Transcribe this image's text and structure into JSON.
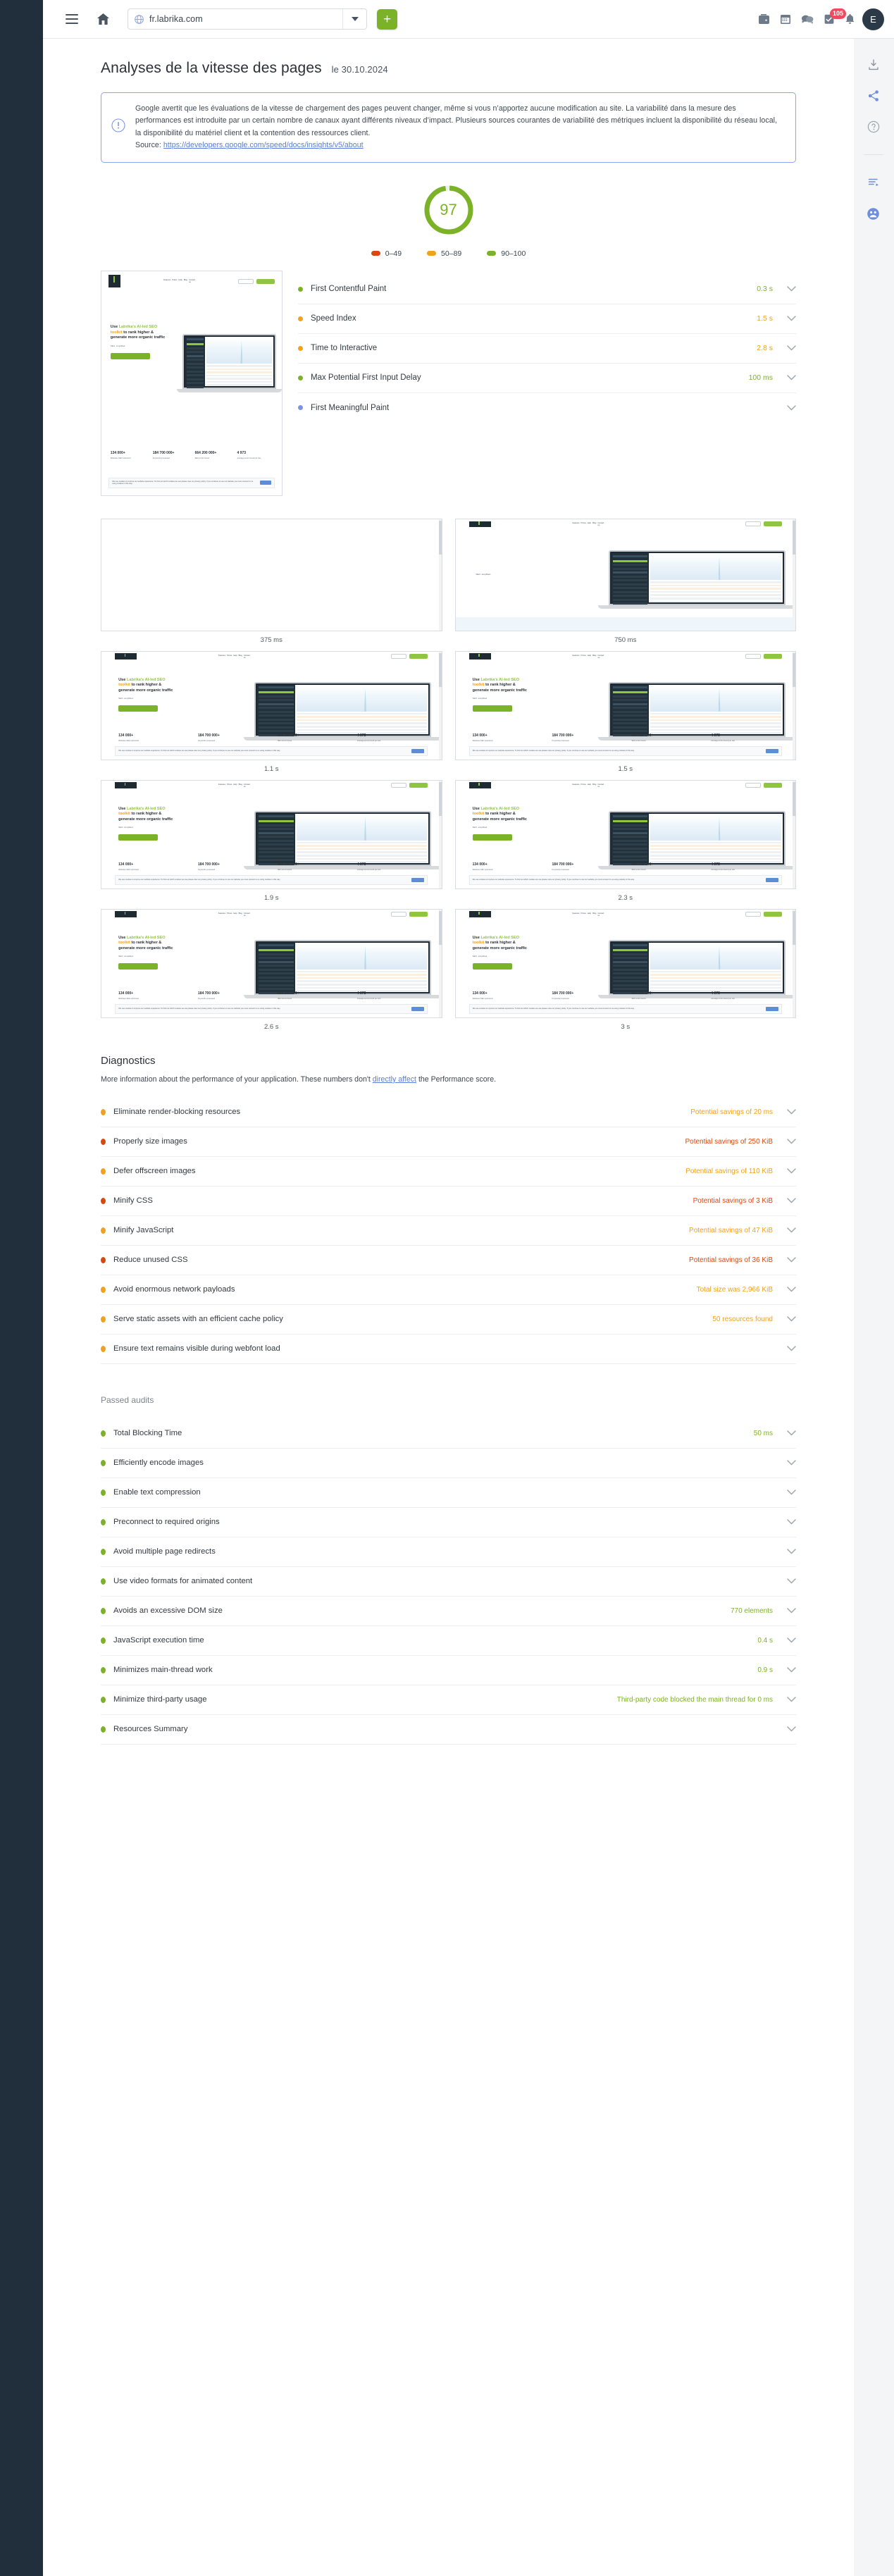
{
  "browser": {
    "menu_icon": "hamburger-icon",
    "home_icon": "home-icon",
    "url": "fr.labrika.com",
    "url_icon": "globe-icon",
    "dropdown_icon": "chevron-down-icon",
    "add_label": "+",
    "icons": [
      "wallet-icon",
      "calendar-icon",
      "chat-icon",
      "tasks-icon",
      "bell-icon"
    ],
    "tasks_badge": "105",
    "avatar_initial": "E"
  },
  "right_rail": {
    "items": [
      "download-icon",
      "share-icon",
      "help-icon",
      "report-icon",
      "support-icon"
    ]
  },
  "page": {
    "title": "Analyses de la vitesse des pages",
    "date": "le 30.10.2024"
  },
  "notice": {
    "icon": "info-icon",
    "text": "Google avertit que les évaluations de la vitesse de chargement des pages peuvent changer, même si vous n’apportez aucune modification au site. La variabilité dans la mesure des performances est introduite par un certain nombre de canaux ayant différents niveaux d’impact. Plusieurs sources courantes de variabilité des métriques incluent la disponibilité du réseau local, la disponibilité du matériel client et la contention des ressources client.",
    "source_label": "Source:",
    "source_url": "https://developers.google.com/speed/docs/insights/v5/about"
  },
  "score": {
    "value": "97",
    "color": "#7cb227",
    "legend": [
      {
        "label": "0–49",
        "color": "#d9480f"
      },
      {
        "label": "50–89",
        "color": "#f0a11e"
      },
      {
        "label": "90–100",
        "color": "#7cb227"
      }
    ]
  },
  "metrics": [
    {
      "label": "First Contentful Paint",
      "value": "0.3 s",
      "color": "#7cb227"
    },
    {
      "label": "Speed Index",
      "value": "1.5 s",
      "color": "#f0a11e"
    },
    {
      "label": "Time to Interactive",
      "value": "2.8 s",
      "color": "#f0a11e"
    },
    {
      "label": "Max Potential First Input Delay",
      "value": "100 ms",
      "color": "#7cb227"
    },
    {
      "label": "First Meaningful Paint",
      "value": "",
      "color": "#7b93e0"
    }
  ],
  "filmstrip": {
    "frames": [
      {
        "caption": "375 ms",
        "state": "blank"
      },
      {
        "caption": "750 ms",
        "state": "partial"
      },
      {
        "caption": "1.1 s",
        "state": "full"
      },
      {
        "caption": "1.5 s",
        "state": "full"
      },
      {
        "caption": "1.9 s",
        "state": "full"
      },
      {
        "caption": "2.3 s",
        "state": "full"
      },
      {
        "caption": "2.6 s",
        "state": "full"
      },
      {
        "caption": "3 s",
        "state": "full"
      }
    ],
    "site": {
      "logo": "Labrika",
      "nav": [
        "Features",
        "Prices",
        "Help",
        "Blog",
        "Contact us"
      ],
      "headline_1": "Use Labrika's AI-led SEO",
      "headline_2": "toolkit to rank higher &",
      "headline_3": "generate more organic traffic",
      "sub": "SEO, simplified.",
      "stats": [
        {
          "value": "134 000+",
          "label": "Websites SEO optimized"
        },
        {
          "value": "184 700 000+",
          "label": "Keywords processed"
        },
        {
          "value": "664 200 000+",
          "label": "SEO errors found"
        },
        {
          "value": "4 973",
          "label": "Average errors found per site"
        }
      ],
      "cookie": "We use cookies to improve our website experience. To find out which cookies we use please view our privacy policy. If you continue to use our website you must consent to us using cookies in this way.",
      "cookie_link": "privacy policy",
      "cookie_button": "ACCEPT"
    }
  },
  "diagnostics": {
    "title": "Diagnostics",
    "subtitle_a": "More information about the performance of your application. These numbers don't ",
    "subtitle_link": "directly affect",
    "subtitle_b": " the Performance score.",
    "items": [
      {
        "label": "Eliminate render-blocking resources",
        "value": "Potential savings of 20 ms",
        "color": "#f0a11e"
      },
      {
        "label": "Properly size images",
        "value": "Potential savings of 250 KiB",
        "color": "#d9480f"
      },
      {
        "label": "Defer offscreen images",
        "value": "Potential savings of 110 KiB",
        "color": "#f0a11e"
      },
      {
        "label": "Minify CSS",
        "value": "Potential savings of 3 KiB",
        "color": "#d9480f"
      },
      {
        "label": "Minify JavaScript",
        "value": "Potential savings of 47 KiB",
        "color": "#f0a11e"
      },
      {
        "label": "Reduce unused CSS",
        "value": "Potential savings of 36 KiB",
        "color": "#d9480f"
      },
      {
        "label": "Avoid enormous network payloads",
        "value": "Total size was 2,966 KiB",
        "color": "#f0a11e"
      },
      {
        "label": "Serve static assets with an efficient cache policy",
        "value": "50 resources found",
        "color": "#f0a11e"
      },
      {
        "label": "Ensure text remains visible during webfont load",
        "value": "",
        "color": "#f0a11e"
      }
    ]
  },
  "passed": {
    "title": "Passed audits",
    "items": [
      {
        "label": "Total Blocking Time",
        "value": "50 ms",
        "color": "#7cb227"
      },
      {
        "label": "Efficiently encode images",
        "value": "",
        "color": "#7cb227"
      },
      {
        "label": "Enable text compression",
        "value": "",
        "color": "#7cb227"
      },
      {
        "label": "Preconnect to required origins",
        "value": "",
        "color": "#7cb227"
      },
      {
        "label": "Avoid multiple page redirects",
        "value": "",
        "color": "#7cb227"
      },
      {
        "label": "Use video formats for animated content",
        "value": "",
        "color": "#7cb227"
      },
      {
        "label": "Avoids an excessive DOM size",
        "value": "770 elements",
        "color": "#7cb227"
      },
      {
        "label": "JavaScript execution time",
        "value": "0.4 s",
        "color": "#7cb227"
      },
      {
        "label": "Minimizes main-thread work",
        "value": "0.9 s",
        "color": "#7cb227"
      },
      {
        "label": "Minimize third-party usage",
        "value": "Third-party code blocked the main thread for 0 ms",
        "color": "#7cb227"
      },
      {
        "label": "Resources Summary",
        "value": "",
        "color": "#7cb227"
      }
    ]
  }
}
